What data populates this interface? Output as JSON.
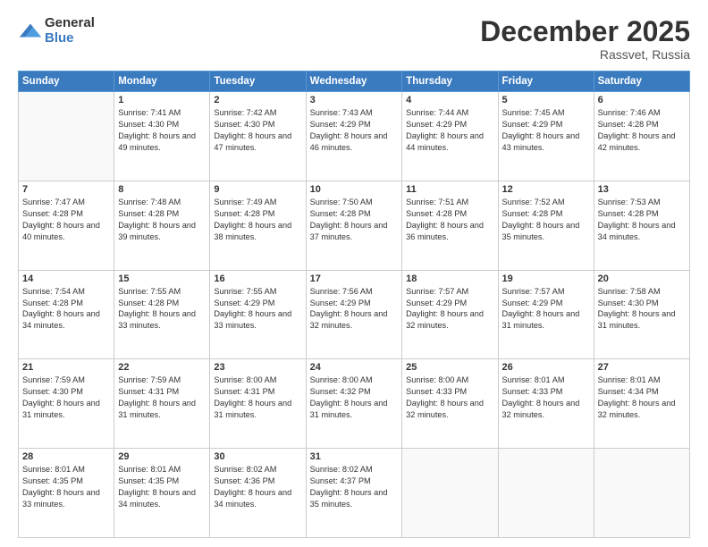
{
  "logo": {
    "general": "General",
    "blue": "Blue"
  },
  "title": "December 2025",
  "subtitle": "Rassvet, Russia",
  "headers": [
    "Sunday",
    "Monday",
    "Tuesday",
    "Wednesday",
    "Thursday",
    "Friday",
    "Saturday"
  ],
  "weeks": [
    [
      {
        "day": "",
        "sunrise": "",
        "sunset": "",
        "daylight": ""
      },
      {
        "day": "1",
        "sunrise": "Sunrise: 7:41 AM",
        "sunset": "Sunset: 4:30 PM",
        "daylight": "Daylight: 8 hours and 49 minutes."
      },
      {
        "day": "2",
        "sunrise": "Sunrise: 7:42 AM",
        "sunset": "Sunset: 4:30 PM",
        "daylight": "Daylight: 8 hours and 47 minutes."
      },
      {
        "day": "3",
        "sunrise": "Sunrise: 7:43 AM",
        "sunset": "Sunset: 4:29 PM",
        "daylight": "Daylight: 8 hours and 46 minutes."
      },
      {
        "day": "4",
        "sunrise": "Sunrise: 7:44 AM",
        "sunset": "Sunset: 4:29 PM",
        "daylight": "Daylight: 8 hours and 44 minutes."
      },
      {
        "day": "5",
        "sunrise": "Sunrise: 7:45 AM",
        "sunset": "Sunset: 4:29 PM",
        "daylight": "Daylight: 8 hours and 43 minutes."
      },
      {
        "day": "6",
        "sunrise": "Sunrise: 7:46 AM",
        "sunset": "Sunset: 4:28 PM",
        "daylight": "Daylight: 8 hours and 42 minutes."
      }
    ],
    [
      {
        "day": "7",
        "sunrise": "Sunrise: 7:47 AM",
        "sunset": "Sunset: 4:28 PM",
        "daylight": "Daylight: 8 hours and 40 minutes."
      },
      {
        "day": "8",
        "sunrise": "Sunrise: 7:48 AM",
        "sunset": "Sunset: 4:28 PM",
        "daylight": "Daylight: 8 hours and 39 minutes."
      },
      {
        "day": "9",
        "sunrise": "Sunrise: 7:49 AM",
        "sunset": "Sunset: 4:28 PM",
        "daylight": "Daylight: 8 hours and 38 minutes."
      },
      {
        "day": "10",
        "sunrise": "Sunrise: 7:50 AM",
        "sunset": "Sunset: 4:28 PM",
        "daylight": "Daylight: 8 hours and 37 minutes."
      },
      {
        "day": "11",
        "sunrise": "Sunrise: 7:51 AM",
        "sunset": "Sunset: 4:28 PM",
        "daylight": "Daylight: 8 hours and 36 minutes."
      },
      {
        "day": "12",
        "sunrise": "Sunrise: 7:52 AM",
        "sunset": "Sunset: 4:28 PM",
        "daylight": "Daylight: 8 hours and 35 minutes."
      },
      {
        "day": "13",
        "sunrise": "Sunrise: 7:53 AM",
        "sunset": "Sunset: 4:28 PM",
        "daylight": "Daylight: 8 hours and 34 minutes."
      }
    ],
    [
      {
        "day": "14",
        "sunrise": "Sunrise: 7:54 AM",
        "sunset": "Sunset: 4:28 PM",
        "daylight": "Daylight: 8 hours and 34 minutes."
      },
      {
        "day": "15",
        "sunrise": "Sunrise: 7:55 AM",
        "sunset": "Sunset: 4:28 PM",
        "daylight": "Daylight: 8 hours and 33 minutes."
      },
      {
        "day": "16",
        "sunrise": "Sunrise: 7:55 AM",
        "sunset": "Sunset: 4:29 PM",
        "daylight": "Daylight: 8 hours and 33 minutes."
      },
      {
        "day": "17",
        "sunrise": "Sunrise: 7:56 AM",
        "sunset": "Sunset: 4:29 PM",
        "daylight": "Daylight: 8 hours and 32 minutes."
      },
      {
        "day": "18",
        "sunrise": "Sunrise: 7:57 AM",
        "sunset": "Sunset: 4:29 PM",
        "daylight": "Daylight: 8 hours and 32 minutes."
      },
      {
        "day": "19",
        "sunrise": "Sunrise: 7:57 AM",
        "sunset": "Sunset: 4:29 PM",
        "daylight": "Daylight: 8 hours and 31 minutes."
      },
      {
        "day": "20",
        "sunrise": "Sunrise: 7:58 AM",
        "sunset": "Sunset: 4:30 PM",
        "daylight": "Daylight: 8 hours and 31 minutes."
      }
    ],
    [
      {
        "day": "21",
        "sunrise": "Sunrise: 7:59 AM",
        "sunset": "Sunset: 4:30 PM",
        "daylight": "Daylight: 8 hours and 31 minutes."
      },
      {
        "day": "22",
        "sunrise": "Sunrise: 7:59 AM",
        "sunset": "Sunset: 4:31 PM",
        "daylight": "Daylight: 8 hours and 31 minutes."
      },
      {
        "day": "23",
        "sunrise": "Sunrise: 8:00 AM",
        "sunset": "Sunset: 4:31 PM",
        "daylight": "Daylight: 8 hours and 31 minutes."
      },
      {
        "day": "24",
        "sunrise": "Sunrise: 8:00 AM",
        "sunset": "Sunset: 4:32 PM",
        "daylight": "Daylight: 8 hours and 31 minutes."
      },
      {
        "day": "25",
        "sunrise": "Sunrise: 8:00 AM",
        "sunset": "Sunset: 4:33 PM",
        "daylight": "Daylight: 8 hours and 32 minutes."
      },
      {
        "day": "26",
        "sunrise": "Sunrise: 8:01 AM",
        "sunset": "Sunset: 4:33 PM",
        "daylight": "Daylight: 8 hours and 32 minutes."
      },
      {
        "day": "27",
        "sunrise": "Sunrise: 8:01 AM",
        "sunset": "Sunset: 4:34 PM",
        "daylight": "Daylight: 8 hours and 32 minutes."
      }
    ],
    [
      {
        "day": "28",
        "sunrise": "Sunrise: 8:01 AM",
        "sunset": "Sunset: 4:35 PM",
        "daylight": "Daylight: 8 hours and 33 minutes."
      },
      {
        "day": "29",
        "sunrise": "Sunrise: 8:01 AM",
        "sunset": "Sunset: 4:35 PM",
        "daylight": "Daylight: 8 hours and 34 minutes."
      },
      {
        "day": "30",
        "sunrise": "Sunrise: 8:02 AM",
        "sunset": "Sunset: 4:36 PM",
        "daylight": "Daylight: 8 hours and 34 minutes."
      },
      {
        "day": "31",
        "sunrise": "Sunrise: 8:02 AM",
        "sunset": "Sunset: 4:37 PM",
        "daylight": "Daylight: 8 hours and 35 minutes."
      },
      {
        "day": "",
        "sunrise": "",
        "sunset": "",
        "daylight": ""
      },
      {
        "day": "",
        "sunrise": "",
        "sunset": "",
        "daylight": ""
      },
      {
        "day": "",
        "sunrise": "",
        "sunset": "",
        "daylight": ""
      }
    ]
  ]
}
